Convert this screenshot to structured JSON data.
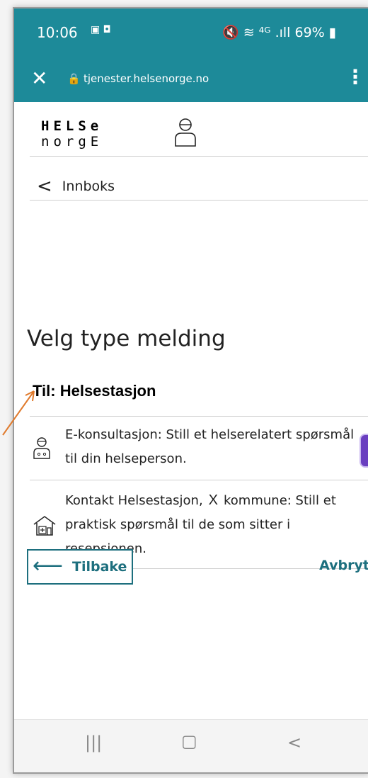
{
  "status": {
    "time": "10:06",
    "left_icons": "▣ ◘",
    "right_icons": "🔇 ≋ ⁴ᴳ .ıll 69% ▮",
    "battery": "69%"
  },
  "browser": {
    "close_icon": "close-icon",
    "url": "tjenester.helsenorge.no",
    "menu_icon": "kebab-menu-icon"
  },
  "brand": {
    "line1": "HELSe",
    "line2": "norgE"
  },
  "nav": {
    "back_label": "Innboks"
  },
  "page": {
    "heading": "Velg type melding",
    "recipient": "Til: Helsestasjon"
  },
  "options": [
    {
      "icon": "doctor-icon",
      "text1": "E-konsultasjon: Still et helserelatert spørsmål",
      "text2": "til din helseperson."
    },
    {
      "icon": "health-building-icon",
      "text_a": "Kontakt Helsestasjon,",
      "x_mark": "X",
      "text_b": "kommune: Still et",
      "text2": "praktisk spørsmål til de som sitter i",
      "text3": "resepsjonen."
    }
  ],
  "actions": {
    "back_button": "Tilbake",
    "cancel_button": "Avbryt"
  },
  "colors": {
    "teal": "#1d8a99",
    "button_teal": "#1d6f7e",
    "annotation": "#e07a2c",
    "purple": "#6a3fc0"
  }
}
